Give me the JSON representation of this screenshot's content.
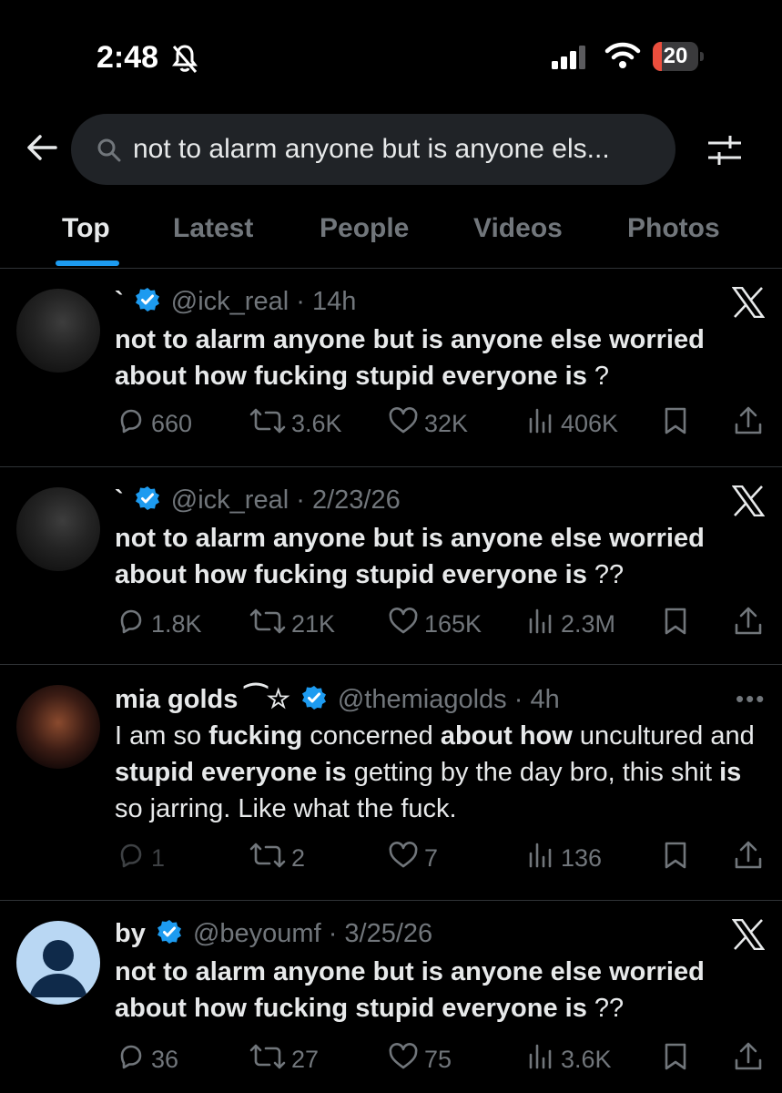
{
  "status_bar": {
    "time": "2:48",
    "battery": "20",
    "battery_level": 0.2
  },
  "search": {
    "query": "not to alarm anyone but is anyone els..."
  },
  "tabs": [
    {
      "label": "Top",
      "active": true
    },
    {
      "label": "Latest"
    },
    {
      "label": "People"
    },
    {
      "label": "Videos"
    },
    {
      "label": "Photos"
    }
  ],
  "tweets": [
    {
      "name": "`",
      "handle": "@ick_real",
      "time": "· 14h",
      "text_bold": "not to alarm anyone but is anyone else worried about how fucking stupid everyone is",
      "text_tail": " ?",
      "replies": "660",
      "retweets": "3.6K",
      "likes": "32K",
      "views": "406K",
      "source_icon": "x-logo-icon"
    },
    {
      "name": "`",
      "handle": "@ick_real",
      "time": "· 2/23/26",
      "text_bold": "not to alarm anyone but is anyone else worried about how fucking stupid everyone is",
      "text_tail": " ??",
      "replies": "1.8K",
      "retweets": "21K",
      "likes": "165K",
      "views": "2.3M",
      "source_icon": "x-logo-icon"
    },
    {
      "name": "mia golds",
      "name_suffix": " ⁀☆",
      "handle": "@themiagolds",
      "time": "· 4h",
      "text_parts": [
        {
          "t": "I am so ",
          "b": false
        },
        {
          "t": "fucking",
          "b": true
        },
        {
          "t": " concerned ",
          "b": false
        },
        {
          "t": "about how",
          "b": true
        },
        {
          "t": " uncultured and ",
          "b": false
        },
        {
          "t": "stupid everyone is",
          "b": true
        },
        {
          "t": " getting by the day bro, this shit ",
          "b": false
        },
        {
          "t": "is",
          "b": true
        },
        {
          "t": " so jarring. Like what the fuck.",
          "b": false
        }
      ],
      "replies": "1",
      "retweets": "2",
      "likes": "7",
      "views": "136",
      "source_icon": "more-icon"
    },
    {
      "name": "by",
      "handle": "@beyoumf",
      "time": "· 3/25/26",
      "text_bold": "not to alarm anyone but is anyone else worried about how fucking stupid everyone is",
      "text_tail": " ??",
      "replies": "36",
      "retweets": "27",
      "likes": "75",
      "views": "3.6K",
      "source_icon": "x-logo-icon"
    }
  ],
  "colors": {
    "accent": "#1d9bf0",
    "muted": "#71767b",
    "text": "#e7e9ea",
    "background": "#000000",
    "battery_low": "#eb4e3d"
  }
}
